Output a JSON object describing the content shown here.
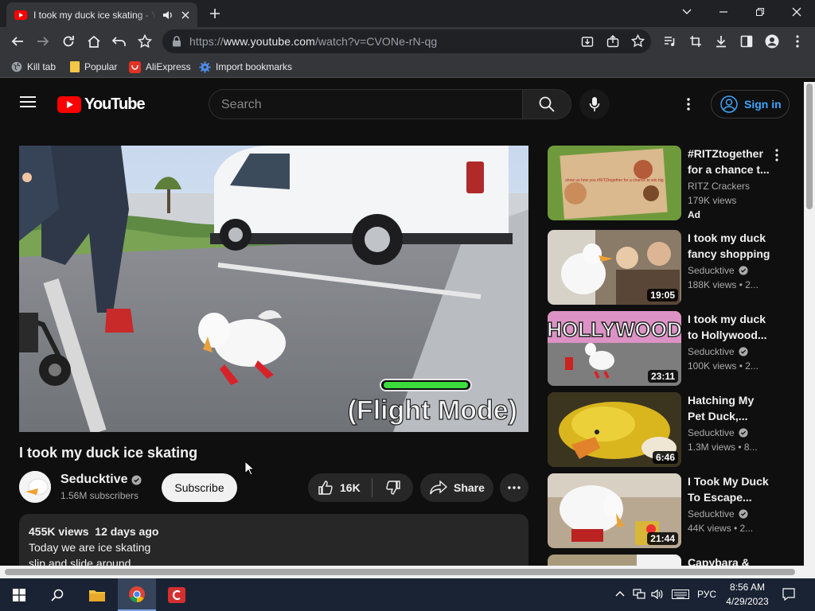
{
  "browser": {
    "tab_title": "I took my duck ice skating - YouTube",
    "url_prefix": "https://",
    "url_host": "www.youtube.com",
    "url_path": "/watch?v=CVONe-rN-qg",
    "bookmarks": [
      "Kill tab",
      "Popular",
      "AliExpress",
      "Import bookmarks"
    ]
  },
  "masthead": {
    "logo_text": "YouTube",
    "search_placeholder": "Search",
    "sign_in": "Sign in"
  },
  "video": {
    "overlay_text": "(Flight Mode)",
    "title": "I took my duck ice skating",
    "channel": "Seducktive",
    "subscribers": "1.56M subscribers",
    "subscribe_label": "Subscribe",
    "likes": "16K",
    "share_label": "Share",
    "views": "455K views",
    "age": "12 days ago",
    "desc_line1": "Today we are ice skating",
    "desc_line2": "slip and slide around"
  },
  "recommendations": [
    {
      "title": "#RITZtogether for a chance t...",
      "channel": "RITZ Crackers",
      "meta": "179K views",
      "badge": "Ad",
      "duration": "",
      "verified": false
    },
    {
      "title": "I took my duck fancy shopping",
      "channel": "Seducktive",
      "meta": "188K views • 2...",
      "duration": "19:05",
      "verified": true
    },
    {
      "title": "I took my duck to Hollywood...",
      "channel": "Seducktive",
      "meta": "100K views • 2...",
      "duration": "23:11",
      "verified": true
    },
    {
      "title": "Hatching My Pet Duck,...",
      "channel": "Seducktive",
      "meta": "1.3M views • 8...",
      "duration": "6:46",
      "verified": true
    },
    {
      "title": "I Took My Duck To Escape...",
      "channel": "Seducktive",
      "meta": "44K views • 2...",
      "duration": "21:44",
      "verified": true
    },
    {
      "title": "Capybara & Cat",
      "channel": "",
      "meta": "",
      "duration": "",
      "verified": false
    }
  ],
  "thumbnail_texts": {
    "ritz_caption": "show us how you #RITZtogether for a chance to win big",
    "hollywood": "HOLLYWOOD"
  },
  "taskbar": {
    "language": "РУС",
    "time": "8:56 AM",
    "date": "4/29/2023"
  },
  "colors": {
    "accent_blue": "#3ea6ff",
    "youtube_red": "#ff0000",
    "page_bg": "#0f0f0f",
    "taskbar": "#1a2333"
  }
}
